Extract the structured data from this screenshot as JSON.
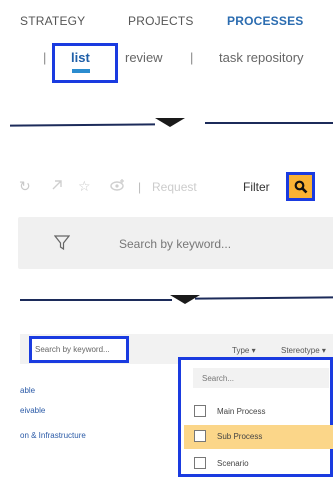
{
  "nav": {
    "strategy": "STRATEGY",
    "projects": "PROJECTS",
    "processes": "PROCESSES"
  },
  "subnav": {
    "separator": "|",
    "list": "list",
    "review": "review",
    "task_repository": "task repository"
  },
  "toolbar": {
    "separator": "|",
    "request": "Request",
    "filter": "Filter"
  },
  "search_panel": {
    "placeholder": "Search by keyword..."
  },
  "table": {
    "search_placeholder": "Search by keyword...",
    "columns": {
      "type": "Type ▾",
      "stereotype": "Stereotype ▾"
    },
    "rows": [
      "able",
      "eivable",
      "on & Infrastructure"
    ]
  },
  "type_dropdown": {
    "search_placeholder": "Search...",
    "options": [
      {
        "label": "Main Process",
        "checked": false,
        "highlighted": false
      },
      {
        "label": "Sub Process",
        "checked": false,
        "highlighted": true
      },
      {
        "label": "Scenario",
        "checked": false,
        "highlighted": false
      }
    ]
  },
  "colors": {
    "highlight_box": "#1a3be0",
    "accent_orange": "#f9b234",
    "selected_row": "#fbd689",
    "active_tab": "#2b6cb0"
  },
  "icons": [
    "refresh-icon",
    "link-icon",
    "add-favorite-icon",
    "add-watch-icon",
    "search-icon",
    "filter-funnel-icon",
    "arrow-down-icon"
  ]
}
